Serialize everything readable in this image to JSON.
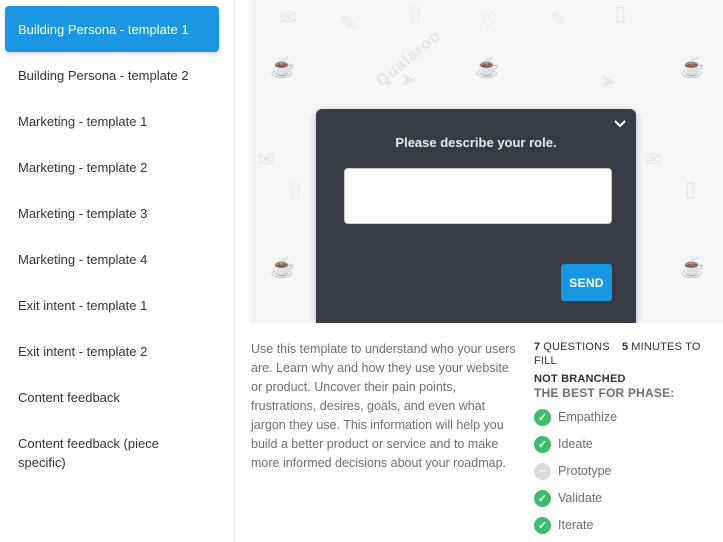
{
  "sidebar": {
    "items": [
      {
        "label": "Building Persona - template 1",
        "active": true
      },
      {
        "label": "Building Persona - template 2"
      },
      {
        "label": "Marketing - template 1"
      },
      {
        "label": "Marketing - template 2"
      },
      {
        "label": "Marketing - template 3"
      },
      {
        "label": "Marketing - template 4"
      },
      {
        "label": "Exit intent - template 1"
      },
      {
        "label": "Exit intent - template 2"
      },
      {
        "label": "Content feedback"
      },
      {
        "label": "Content feedback (piece specific)"
      }
    ]
  },
  "preview": {
    "watermark": "Qualaroo",
    "widget": {
      "question": "Please describe your role.",
      "answer_value": "",
      "send_label": "SEND",
      "collapse_icon": "chevron-down-icon"
    }
  },
  "description": "Use this template to understand who your users are. Learn why and how they use your website or product. Uncover their pain points, frustrations, desires, goals, and even what jargon they use. This information will help you build a better product or service and to make more informed decisions about your roadmap.",
  "meta": {
    "questions_count": "7",
    "questions_label": "QUESTIONS",
    "minutes_count": "5",
    "minutes_label": "MINUTES TO FILL",
    "branching": "NOT BRANCHED"
  },
  "phases": {
    "title": "THE BEST FOR PHASE:",
    "items": [
      {
        "label": "Empathize",
        "enabled": true
      },
      {
        "label": "Ideate",
        "enabled": true
      },
      {
        "label": "Prototype",
        "enabled": false
      },
      {
        "label": "Validate",
        "enabled": true
      },
      {
        "label": "Iterate",
        "enabled": true
      }
    ]
  },
  "colors": {
    "accent": "#1a96e2",
    "widget_bg": "#383b44",
    "check_on": "#3dbc6e",
    "check_off": "#d9dbde"
  }
}
